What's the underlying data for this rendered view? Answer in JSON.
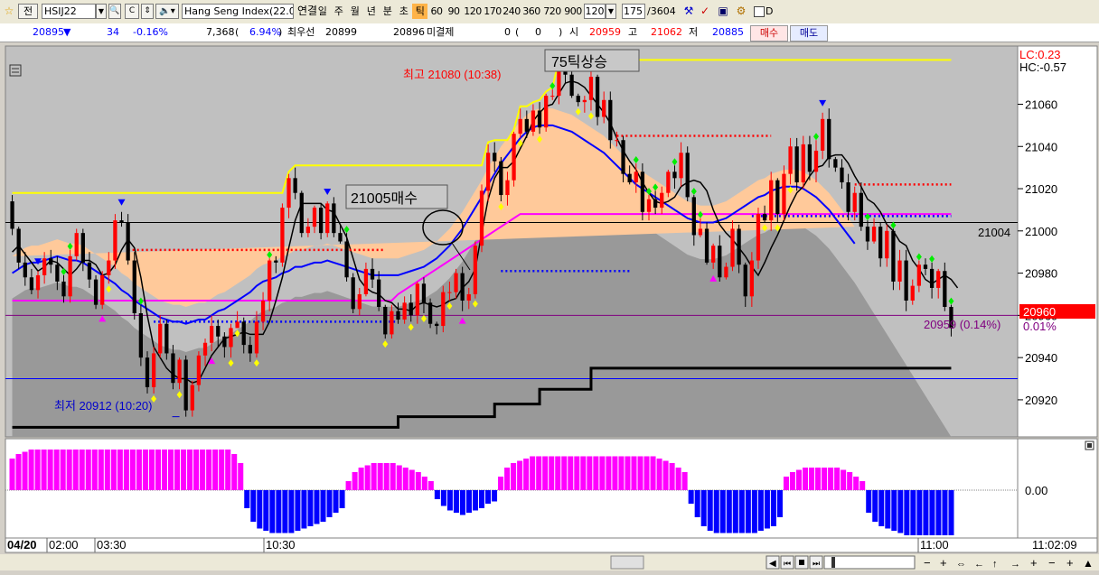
{
  "toolbar": {
    "star": "☆",
    "mode": "전",
    "code": "HSIJ22",
    "name_box": "Hang Seng Index(22.0",
    "link": "연결",
    "periods": [
      "일",
      "주",
      "월",
      "년",
      "분",
      "초",
      "틱",
      "60",
      "90",
      "120",
      "170",
      "240",
      "360",
      "720",
      "900"
    ],
    "selected_period": "틱",
    "tick_value": "120",
    "count_value": "175",
    "total_count": "/3604",
    "checkbox_label": "D"
  },
  "quote": {
    "price": "20895",
    "arrow": "▼",
    "change": "34",
    "change_pct": "-0.16%",
    "volume": "7,368",
    "vol_pct": "6.94%",
    "best_ask_label": "최우선",
    "best_ask": "20899",
    "best_bid": "20896",
    "oi_label": "미결제",
    "oi": "0",
    "oi_change": "0",
    "open_label": "시",
    "open": "20959",
    "high_label": "고",
    "high": "21062",
    "low_label": "저",
    "low": "20885",
    "buy_button": "매수",
    "sell_button": "매도"
  },
  "colors": {
    "up": "#ff0000",
    "down": "#000000",
    "ma_blue": "#0000ff",
    "line_yellow": "#ffff00",
    "line_magenta": "#ff00ff",
    "band": "#ffc99a",
    "cloud": "#999999",
    "osc_pos": "#ff00ff",
    "osc_neg": "#0000ff",
    "current_price_bg": "#ff0000"
  },
  "chart_data": {
    "type": "candlestick",
    "y_axis_ticks": [
      "21060",
      "21040",
      "21020",
      "21000",
      "20980",
      "20960",
      "20940",
      "20920"
    ],
    "ylim": [
      20905,
      21085
    ],
    "x_ticks": [
      {
        "label": "04/20",
        "bold": true
      },
      {
        "label": "02:00"
      },
      {
        "label": "03:30"
      },
      {
        "label": "10:30"
      },
      {
        "label": "11:00"
      },
      {
        "label": "11:02:09"
      }
    ],
    "candles": [
      [
        21014,
        21001,
        21017,
        20998
      ],
      [
        21001,
        20985,
        21002,
        20982
      ],
      [
        20985,
        20978,
        20990,
        20974
      ],
      [
        20978,
        20972,
        20982,
        20970
      ],
      [
        20972,
        20979,
        20981,
        20968
      ],
      [
        20979,
        20987,
        20990,
        20975
      ],
      [
        20987,
        20984,
        20991,
        20980
      ],
      [
        20984,
        20976,
        20988,
        20972
      ],
      [
        20976,
        20969,
        20979,
        20966
      ],
      [
        20969,
        20988,
        20991,
        20966
      ],
      [
        20988,
        20999,
        21001,
        20986
      ],
      [
        20999,
        20985,
        21001,
        20981
      ],
      [
        20985,
        20977,
        20990,
        20973
      ],
      [
        20977,
        20965,
        20979,
        20963
      ],
      [
        20965,
        20979,
        20981,
        20963
      ],
      [
        20979,
        20986,
        20990,
        20975
      ],
      [
        20986,
        21005,
        21008,
        20982
      ],
      [
        21005,
        21004,
        21009,
        21002
      ],
      [
        21004,
        20986,
        21008,
        20984
      ],
      [
        20986,
        20961,
        20990,
        20958
      ],
      [
        20961,
        20940,
        20965,
        20936
      ],
      [
        20940,
        20926,
        20943,
        20923
      ],
      [
        20926,
        20942,
        20945,
        20923
      ],
      [
        20942,
        20956,
        20960,
        20940
      ],
      [
        20956,
        20942,
        20958,
        20939
      ],
      [
        20942,
        20928,
        20946,
        20925
      ],
      [
        20928,
        20939,
        20940,
        20925
      ],
      [
        20939,
        20915,
        20941,
        20912
      ],
      [
        20915,
        20927,
        20929,
        20912
      ],
      [
        20927,
        20941,
        20943,
        20924
      ],
      [
        20941,
        20947,
        20949,
        20936
      ],
      [
        20947,
        20955,
        20960,
        20943
      ],
      [
        20955,
        20950,
        20958,
        20945
      ],
      [
        20950,
        20945,
        20952,
        20940
      ],
      [
        20945,
        20954,
        20956,
        20940
      ],
      [
        20954,
        20957,
        20962,
        20954
      ],
      [
        20957,
        20946,
        20959,
        20942
      ],
      [
        20946,
        20942,
        20950,
        20938
      ],
      [
        20942,
        20957,
        20962,
        20940
      ],
      [
        20957,
        20967,
        20971,
        20953
      ],
      [
        20967,
        20986,
        20987,
        20962
      ],
      [
        20986,
        20985,
        20988,
        20980
      ],
      [
        20985,
        21011,
        21013,
        20983
      ],
      [
        21011,
        21025,
        21027,
        21006
      ],
      [
        21025,
        21018,
        21030,
        21015
      ],
      [
        21018,
        20999,
        21019,
        20997
      ],
      [
        20999,
        21002,
        21006,
        20997
      ],
      [
        21002,
        21011,
        21012,
        20999
      ],
      [
        21011,
        20999,
        21013,
        20996
      ],
      [
        20999,
        21013,
        21014,
        20997
      ],
      [
        21013,
        20999,
        21016,
        20997
      ],
      [
        20999,
        20995,
        21003,
        20994
      ],
      [
        20995,
        20978,
        20999,
        20976
      ],
      [
        20978,
        20963,
        20980,
        20961
      ],
      [
        20963,
        20970,
        20973,
        20960
      ],
      [
        20970,
        20982,
        20985,
        20969
      ],
      [
        20982,
        20977,
        20987,
        20973
      ],
      [
        20977,
        20964,
        20981,
        20962
      ],
      [
        20964,
        20951,
        20965,
        20949
      ],
      [
        20951,
        20962,
        20965,
        20949
      ],
      [
        20962,
        20958,
        20966,
        20956
      ],
      [
        20958,
        20966,
        20969,
        20956
      ],
      [
        20966,
        20960,
        20970,
        20957
      ],
      [
        20960,
        20975,
        20976,
        20956
      ],
      [
        20975,
        20966,
        20978,
        20961
      ],
      [
        20966,
        20956,
        20968,
        20954
      ],
      [
        20956,
        20955,
        20957,
        20951
      ],
      [
        20955,
        20971,
        20974,
        20952
      ],
      [
        20971,
        20971,
        20976,
        20967
      ],
      [
        20971,
        20980,
        20982,
        20968
      ],
      [
        20980,
        20967,
        20983,
        20962
      ],
      [
        20967,
        20970,
        20973,
        20963
      ],
      [
        20970,
        20993,
        20995,
        20968
      ],
      [
        20993,
        21019,
        21022,
        20990
      ],
      [
        21019,
        21037,
        21041,
        21014
      ],
      [
        21037,
        21033,
        21042,
        21028
      ],
      [
        21033,
        21017,
        21035,
        21014
      ],
      [
        21017,
        21024,
        21028,
        21012
      ],
      [
        21024,
        21046,
        21047,
        21021
      ],
      [
        21046,
        21053,
        21058,
        21044
      ],
      [
        21053,
        21047,
        21057,
        21044
      ],
      [
        21047,
        21057,
        21060,
        21045
      ],
      [
        21057,
        21049,
        21061,
        21046
      ],
      [
        21049,
        21064,
        21065,
        21047
      ],
      [
        21064,
        21064,
        21067,
        21062
      ],
      [
        21064,
        21078,
        21080,
        21060
      ],
      [
        21078,
        21074,
        21079,
        21070
      ],
      [
        21074,
        21064,
        21076,
        21063
      ],
      [
        21064,
        21061,
        21065,
        21059
      ],
      [
        21061,
        21062,
        21064,
        21056
      ],
      [
        21062,
        21073,
        21077,
        21057
      ],
      [
        21073,
        21054,
        21074,
        21050
      ],
      [
        21054,
        21062,
        21066,
        21051
      ],
      [
        21062,
        21043,
        21066,
        21039
      ],
      [
        21043,
        21043,
        21047,
        21040
      ],
      [
        21043,
        21027,
        21045,
        21023
      ],
      [
        21027,
        21023,
        21031,
        21022
      ],
      [
        21023,
        21028,
        21032,
        21018
      ],
      [
        21028,
        21009,
        21032,
        21005
      ],
      [
        21009,
        21015,
        21017,
        21005
      ],
      [
        21015,
        21011,
        21019,
        21008
      ],
      [
        21011,
        21018,
        21021,
        21008
      ],
      [
        21018,
        21028,
        21029,
        21016
      ],
      [
        21028,
        21025,
        21031,
        21020
      ],
      [
        21025,
        21037,
        21042,
        21021
      ],
      [
        21037,
        21016,
        21040,
        21014
      ],
      [
        21016,
        20998,
        21017,
        20993
      ],
      [
        20998,
        21001,
        21006,
        20997
      ],
      [
        21001,
        20985,
        21004,
        20984
      ],
      [
        20985,
        20993,
        20994,
        20982
      ],
      [
        20993,
        20978,
        20998,
        20976
      ],
      [
        20978,
        20983,
        20985,
        20977
      ],
      [
        20983,
        21001,
        21005,
        20981
      ],
      [
        21001,
        20984,
        21003,
        20980
      ],
      [
        20984,
        20969,
        20985,
        20964
      ],
      [
        20969,
        20986,
        20990,
        20964
      ],
      [
        20986,
        21008,
        21011,
        20982
      ],
      [
        21008,
        21005,
        21012,
        21004
      ],
      [
        21005,
        21024,
        21028,
        21000
      ],
      [
        21024,
        21008,
        21025,
        21004
      ],
      [
        21008,
        21027,
        21031,
        21005
      ],
      [
        21027,
        21040,
        21044,
        21022
      ],
      [
        21040,
        21023,
        21044,
        21019
      ],
      [
        21023,
        21041,
        21045,
        21020
      ],
      [
        21041,
        21028,
        21045,
        21024
      ],
      [
        21028,
        21038,
        21043,
        21023
      ],
      [
        21038,
        21053,
        21056,
        21034
      ],
      [
        21053,
        21034,
        21058,
        21030
      ],
      [
        21034,
        21030,
        21035,
        21028
      ],
      [
        21030,
        21023,
        21034,
        21020
      ],
      [
        21023,
        21009,
        21027,
        21005
      ],
      [
        21009,
        21018,
        21021,
        21005
      ],
      [
        21018,
        21002,
        21023,
        21000
      ],
      [
        21002,
        20995,
        21005,
        20991
      ],
      [
        20995,
        21002,
        21006,
        20994
      ],
      [
        21002,
        20987,
        21004,
        20983
      ],
      [
        20987,
        21000,
        21003,
        20983
      ],
      [
        21000,
        20976,
        21001,
        20972
      ],
      [
        20976,
        20986,
        20991,
        20972
      ],
      [
        20986,
        20967,
        20991,
        20962
      ],
      [
        20967,
        20974,
        20977,
        20965
      ],
      [
        20974,
        20984,
        20986,
        20971
      ],
      [
        20984,
        20982,
        20987,
        20979
      ],
      [
        20982,
        20973,
        20985,
        20968
      ],
      [
        20973,
        20981,
        20982,
        20968
      ],
      [
        20981,
        20964,
        20985,
        20962
      ],
      [
        20964,
        20954,
        20965,
        20950
      ]
    ],
    "moving_average_short": [
      20990,
      20993,
      20989,
      20985,
      20981,
      20983,
      20986,
      20985,
      20982,
      20979,
      20982,
      20986,
      20986,
      20984,
      20979,
      20980,
      20984,
      20991,
      20996,
      20992,
      20978,
      20960,
      20945,
      20940,
      20935,
      20932,
      20930,
      20930,
      20928,
      20929,
      20935,
      20941,
      20945,
      20949,
      20950,
      20951,
      20952,
      20951,
      20951,
      20951,
      20957,
      20967,
      20978,
      20992,
      21005,
      21013,
      21013,
      21013,
      21013,
      21010,
      21009,
      21003,
      20997,
      20987,
      20977,
      20973,
      20971,
      20970,
      20967,
      20966,
      20963,
      20963,
      20962,
      20965,
      20966,
      20965,
      20964,
      20965,
      20967,
      20968,
      20973,
      20976,
      20982,
      20999,
      21015,
      21025,
      21030,
      21030,
      21033,
      21039,
      21045,
      21052,
      21056,
      21059,
      21060,
      21065,
      21070,
      21071,
      21070,
      21068,
      21064,
      21060,
      21056,
      21051,
      21044,
      21038,
      21033,
      21029,
      21023,
      21018,
      21014,
      21013,
      21014,
      21016,
      21021,
      21023,
      21024,
      21023,
      21019,
      21010,
      21003,
      20999,
      20996,
      20992,
      20988,
      20983,
      20979,
      20985,
      20992,
      20998,
      21005,
      21012,
      21018,
      21021,
      21026,
      21030,
      21031,
      21035,
      21036,
      21036,
      21032,
      21026,
      21021,
      21015,
      21013,
      21009,
      21003,
      21000,
      20995,
      20993,
      20986,
      20982,
      20977,
      20975,
      20977,
      20979,
      20977,
      20973
    ],
    "moving_average_long": [
      20980,
      20982,
      20984,
      20985,
      20985,
      20986,
      20987,
      20988,
      20987,
      20986,
      20986,
      20985,
      20983,
      20981,
      20979,
      20977,
      20975,
      20972,
      20970,
      20967,
      20965,
      20963,
      20961,
      20959,
      20958,
      20957,
      20957,
      20956,
      20957,
      20958,
      20958,
      20960,
      20962,
      20963,
      20965,
      20967,
      20969,
      20971,
      20974,
      20976,
      20977,
      20978,
      20980,
      20981,
      20983,
      20983,
      20984,
      20985,
      20985,
      20986,
      20985,
      20984,
      20983,
      20982,
      20981,
      20980,
      20979,
      20979,
      20979,
      20979,
      20979,
      20980,
      20981,
      20982,
      20983,
      20985,
      20987,
      20990,
      20993,
      20997,
      21001,
      21006,
      21011,
      21016,
      21022,
      21027,
      21032,
      21036,
      21040,
      21044,
      21047,
      21049,
      21050,
      21050,
      21050,
      21049,
      21048,
      21047,
      21045,
      21043,
      21041,
      21039,
      21037,
      21034,
      21031,
      21028,
      21025,
      21022,
      21020,
      21018,
      21016,
      21014,
      21012,
      21010,
      21008,
      21006,
      21005,
      21004,
      21004,
      21004,
      21005,
      21006,
      21008,
      21010,
      21012,
      21014,
      21016,
      21017,
      21019,
      21020,
      21021,
      21021,
      21021,
      21020,
      21018,
      21016,
      21013,
      21010,
      21006,
      21002,
      20998,
      20994
    ],
    "reference_lines": [
      {
        "value": 20960,
        "color": "#800080"
      },
      {
        "value": 20930,
        "color": "#0000ff"
      },
      {
        "value": 21004,
        "color": "#000000"
      }
    ],
    "current_price": "20960",
    "current_price_label": "20959 (0.14%)",
    "current_pct_label": "0.01%",
    "line_label_21004": "21004",
    "top_right_lc": "LC:0.23",
    "top_right_hc": "HC:-0.57",
    "high_marker": "최고 21080 (10:38)",
    "low_marker": "최저 20912 (10:20)",
    "annotation_box_1": "75틱상승",
    "annotation_box_2": "21005매수",
    "oscillator": {
      "zero_label": "0.00",
      "values": [
        0.7,
        0.8,
        0.85,
        0.9,
        0.9,
        0.9,
        0.9,
        0.9,
        0.9,
        0.9,
        0.9,
        0.9,
        0.9,
        0.9,
        0.9,
        0.9,
        0.9,
        0.9,
        0.9,
        0.9,
        0.9,
        0.9,
        0.9,
        0.9,
        0.9,
        0.9,
        0.9,
        0.9,
        0.9,
        0.9,
        0.9,
        0.9,
        0.9,
        0.9,
        0.9,
        0.8,
        0.6,
        -0.4,
        -0.7,
        -0.85,
        -0.9,
        -0.95,
        -0.95,
        -0.95,
        -0.95,
        -0.9,
        -0.85,
        -0.8,
        -0.75,
        -0.7,
        -0.6,
        -0.5,
        -0.4,
        0.2,
        0.4,
        0.5,
        0.55,
        0.6,
        0.6,
        0.6,
        0.6,
        0.55,
        0.5,
        0.45,
        0.4,
        0.3,
        0.2,
        -0.2,
        -0.35,
        -0.45,
        -0.5,
        -0.55,
        -0.5,
        -0.45,
        -0.4,
        -0.3,
        -0.25,
        0.3,
        0.5,
        0.6,
        0.65,
        0.7,
        0.75,
        0.75,
        0.75,
        0.75,
        0.75,
        0.75,
        0.75,
        0.75,
        0.75,
        0.75,
        0.75,
        0.75,
        0.75,
        0.75,
        0.75,
        0.75,
        0.75,
        0.75,
        0.75,
        0.75,
        0.7,
        0.65,
        0.6,
        0.5,
        0.4,
        -0.3,
        -0.6,
        -0.8,
        -0.9,
        -0.95,
        -0.95,
        -0.95,
        -0.95,
        -0.95,
        -0.95,
        -0.95,
        -0.9,
        -0.85,
        -0.8,
        -0.6,
        0.3,
        0.4,
        0.45,
        0.5,
        0.5,
        0.5,
        0.5,
        0.5,
        0.5,
        0.45,
        0.4,
        0.3,
        0.2,
        -0.5,
        -0.7,
        -0.8,
        -0.85,
        -0.9,
        -0.95,
        -1,
        -1,
        -1,
        -1,
        -1,
        -1,
        -1,
        -1
      ]
    }
  }
}
